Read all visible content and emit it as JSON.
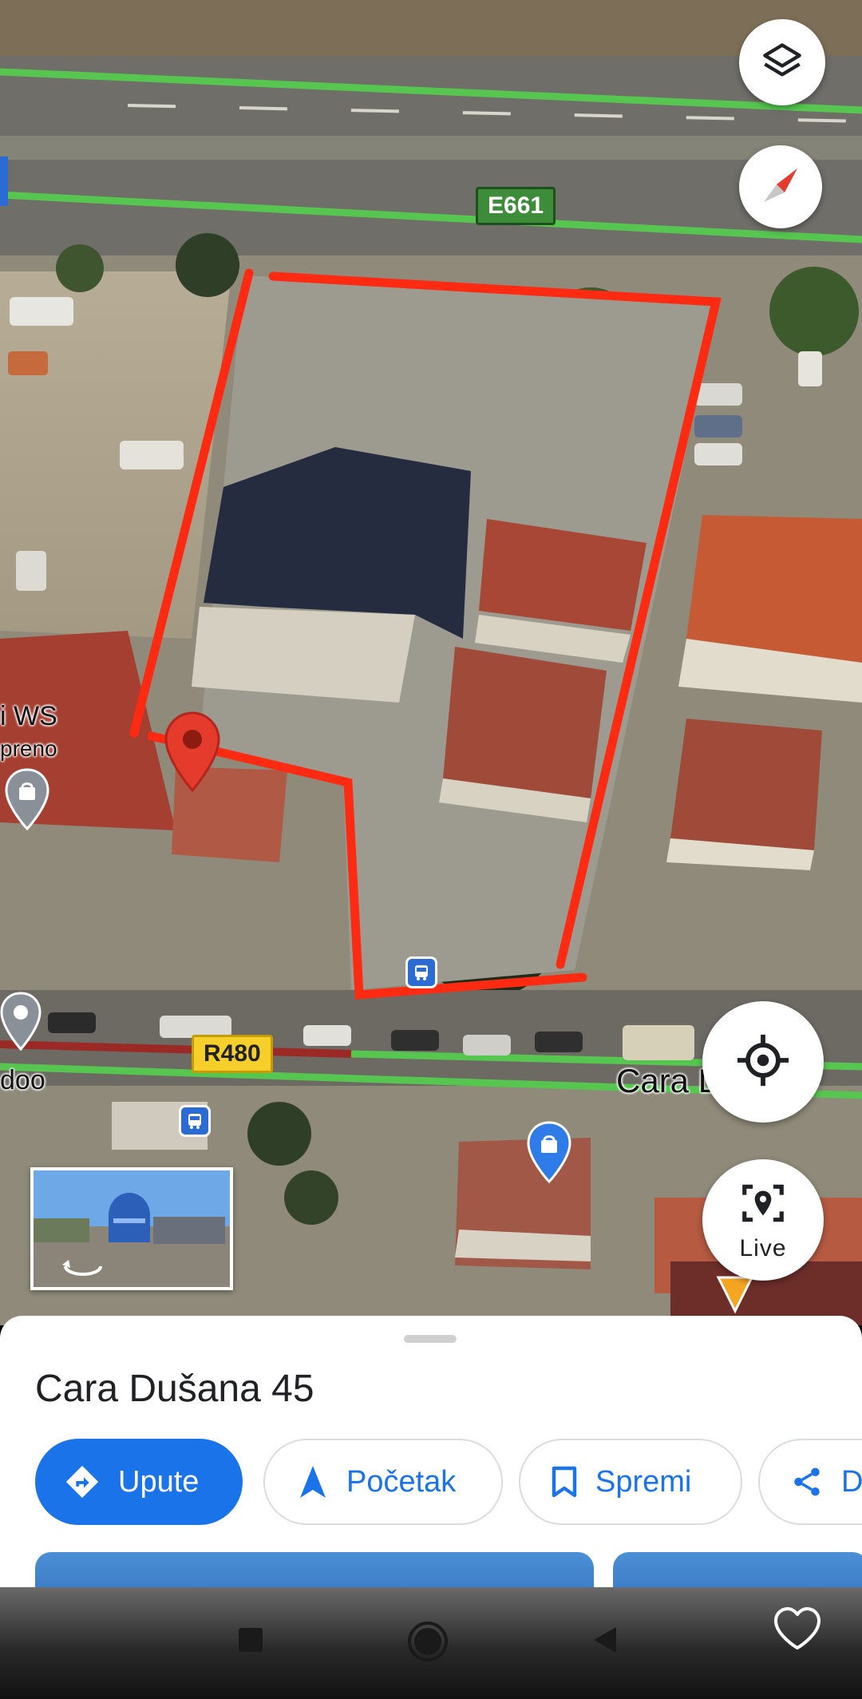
{
  "map": {
    "road_badges": {
      "e661": "E661",
      "r480": "R480"
    },
    "labels": {
      "ws": "i WS",
      "preno": "preno",
      "doo": "doo",
      "cara": "Cara D"
    },
    "controls": {
      "layers_icon": "layers-icon",
      "compass_icon": "compass-icon",
      "locate_icon": "my-location-icon",
      "live_icon": "live-view-icon",
      "live_label": "Live"
    },
    "colors": {
      "road_highlight": "#56c650",
      "outline": "#ff2a12",
      "pin": "#e53b2c"
    }
  },
  "place": {
    "title": "Cara Dušana 45",
    "actions": [
      {
        "label": "Upute",
        "icon": "directions-icon"
      },
      {
        "label": "Početak",
        "icon": "navigation-arrow-icon"
      },
      {
        "label": "Spremi",
        "icon": "bookmark-icon"
      },
      {
        "label": "D",
        "icon": "share-icon"
      }
    ]
  },
  "navbar": {
    "icons": [
      "recents-icon",
      "home-icon",
      "back-icon",
      "heart-icon"
    ]
  },
  "accent": "#1a73e8"
}
